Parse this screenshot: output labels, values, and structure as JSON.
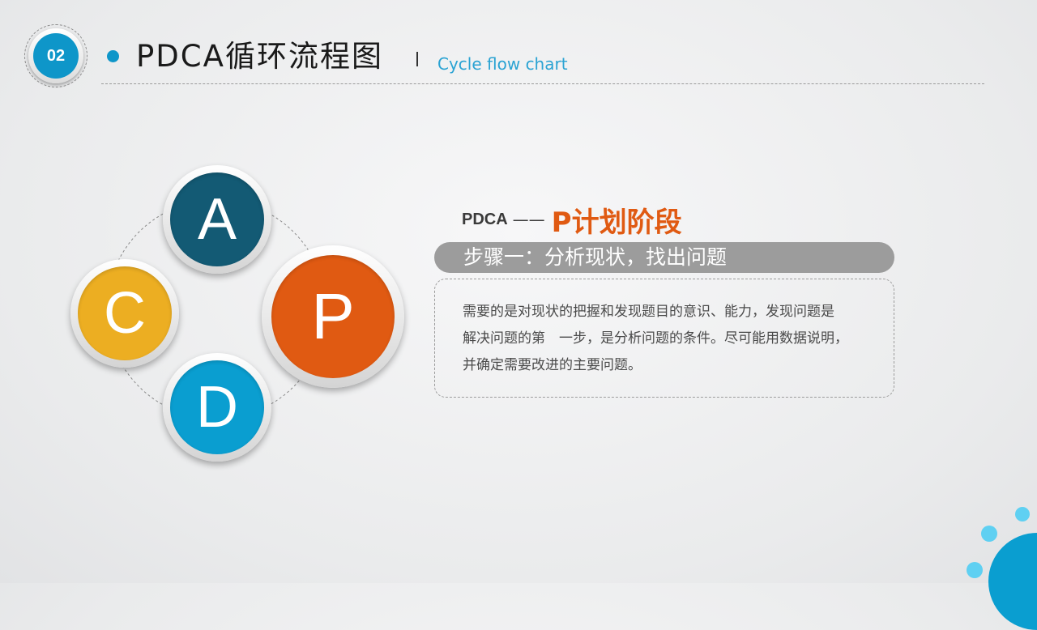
{
  "header": {
    "badge": "02",
    "title": "PDCA循环流程图",
    "subtitle": "Cycle flow chart"
  },
  "diagram": {
    "nodes": [
      {
        "letter": "A",
        "color": "#135a74"
      },
      {
        "letter": "P",
        "color": "#e05a12"
      },
      {
        "letter": "C",
        "color": "#ecae22"
      },
      {
        "letter": "D",
        "color": "#0a9ed0"
      }
    ]
  },
  "content": {
    "prefix": "PDCA",
    "dash": "——",
    "stage_title": "P计划阶段",
    "step_label": "步骤一：分析现状，找出问题",
    "description": "需要的是对现状的把握和发现题目的意识、能力，发现问题是\n解决问题的第　一步，是分析问题的条件。尽可能用数据说明，\n并确定需要改进的主要问题。"
  },
  "colors": {
    "accent_blue": "#0e96c9",
    "accent_orange": "#e05a12",
    "pill_gray": "#9c9c9c"
  }
}
